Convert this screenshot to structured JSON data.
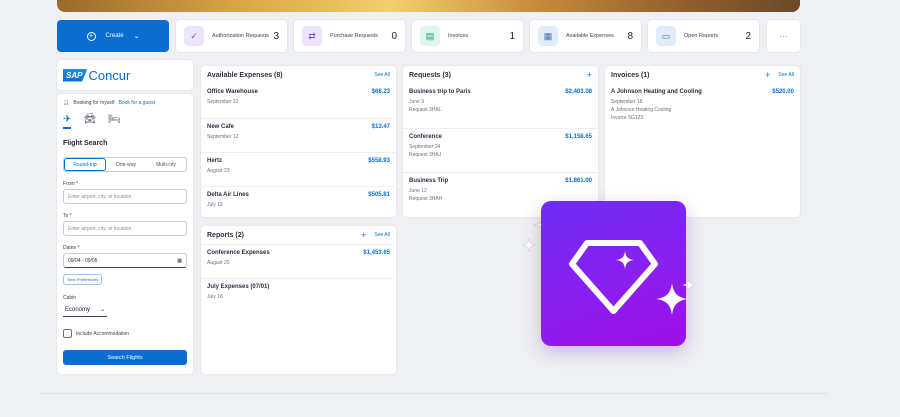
{
  "create": {
    "label": "Create"
  },
  "stats": [
    {
      "label": "Authorization Requests",
      "count": "3",
      "icon": "check-icon"
    },
    {
      "label": "Purchase Requests",
      "count": "0",
      "icon": "arrows-icon"
    },
    {
      "label": "Invoices",
      "count": "1",
      "icon": "invoice-icon"
    },
    {
      "label": "Available Expenses",
      "count": "8",
      "icon": "expense-icon"
    },
    {
      "label": "Open Reports",
      "count": "2",
      "icon": "folder-icon"
    }
  ],
  "more_label": "···",
  "brand": {
    "sap": "SAP",
    "name": "Concur"
  },
  "flight": {
    "booking_for": "Booking for myself",
    "book_guest": "Book for a guest",
    "title": "Flight Search",
    "trip_types": [
      "Round-trip",
      "One-way",
      "Multi-city"
    ],
    "from_label": "From *",
    "from_placeholder": "Enter airport, city, or location",
    "to_label": "To *",
    "to_placeholder": "Enter airport, city, or location",
    "dates_label": "Dates *",
    "dates_value": "09/04 - 09/05",
    "prefs_label": "Time Preferences",
    "cabin_label": "Cabin",
    "cabin_value": "Economy",
    "include_accom": "Include Accommodation",
    "search_label": "Search Flights"
  },
  "expenses": {
    "title": "Available Expenses (8)",
    "see_all": "See All",
    "items": [
      {
        "name": "Office Warehouse",
        "amount": "$68.23",
        "date": "September 21"
      },
      {
        "name": "New Cafe",
        "amount": "$13.47",
        "date": "September 12"
      },
      {
        "name": "Hertz",
        "amount": "$558.93",
        "date": "August 23"
      },
      {
        "name": "Delta Air Lines",
        "amount": "$505.81",
        "date": "July 12"
      }
    ]
  },
  "reports": {
    "title": "Reports (2)",
    "see_all": "See All",
    "items": [
      {
        "name": "Conference Expenses",
        "amount": "$1,453.65",
        "date": "August 20"
      },
      {
        "name": "July Expenses (07/01)",
        "amount": "",
        "date": "July 16"
      }
    ]
  },
  "requests": {
    "title": "Requests (3)",
    "items": [
      {
        "name": "Business trip to Paris",
        "amount": "$2,403.08",
        "date": "June 9",
        "sub": "Request 3HAL"
      },
      {
        "name": "Conference",
        "amount": "$1,158.65",
        "date": "September 24",
        "sub": "Request 3HAJ"
      },
      {
        "name": "Business Trip",
        "amount": "$1,861.00",
        "date": "June 12",
        "sub": "Request 3HAH"
      }
    ]
  },
  "invoices": {
    "title": "Invoices (1)",
    "see_all": "See All",
    "items": [
      {
        "name": "A Johnson Heating and Cooling",
        "amount": "$520.00",
        "date": "September 18",
        "sub1": "A Johnson Heating Cooling",
        "sub2": "Invoice 5G123"
      }
    ]
  },
  "colors": {
    "accent": "#0a6ed1",
    "app_icon_start": "#6d2cf5",
    "app_icon_end": "#a00fe6"
  }
}
